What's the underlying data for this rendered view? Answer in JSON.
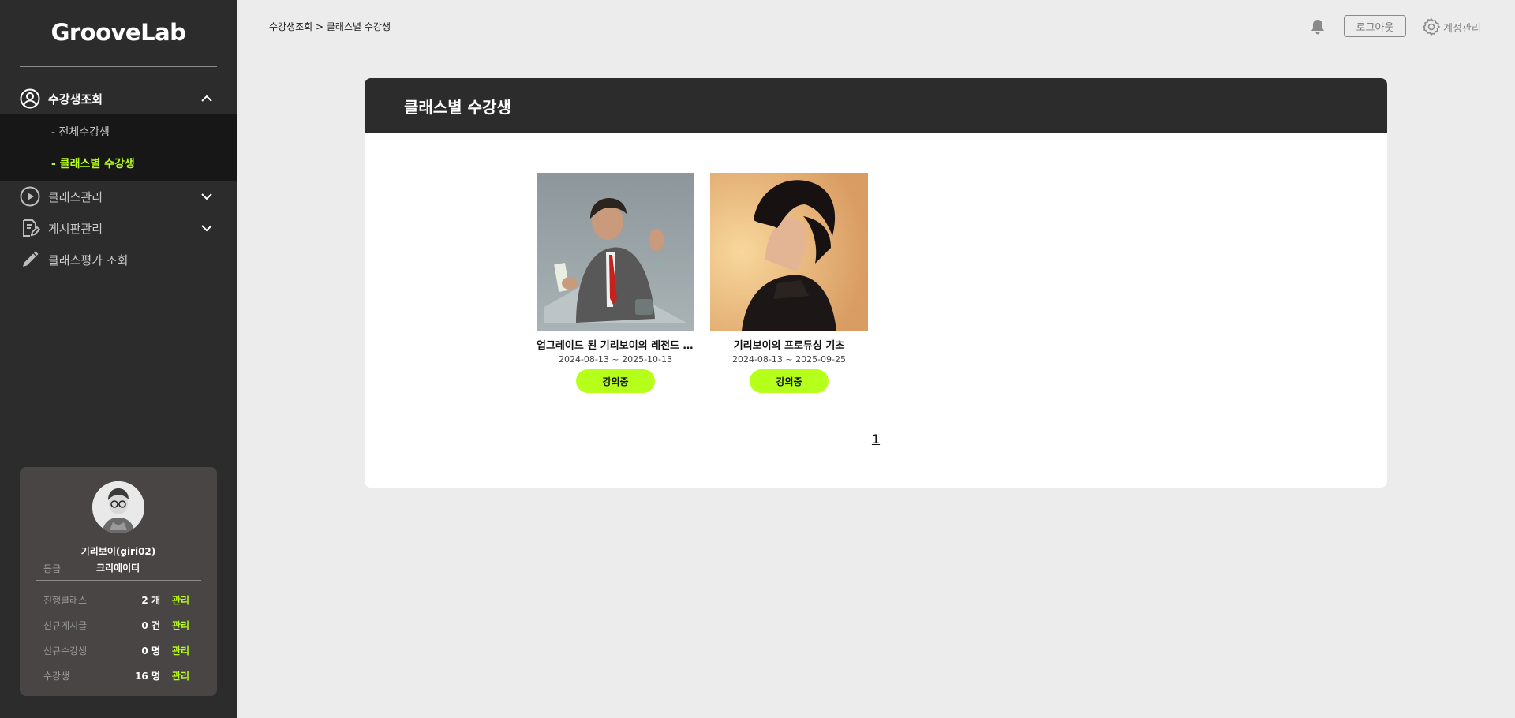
{
  "sidebar": {
    "logo": "GrooveLab",
    "menu": [
      {
        "label": "수강생조회",
        "icon": "user-circle-icon",
        "expanded": true
      },
      {
        "label": "클래스관리",
        "icon": "play-circle-icon",
        "expanded": false
      },
      {
        "label": "게시판관리",
        "icon": "document-edit-icon",
        "expanded": false
      },
      {
        "label": "클래스평가 조회",
        "icon": "pencil-icon"
      }
    ],
    "submenu": [
      {
        "label": "- 전체수강생",
        "current": false
      },
      {
        "label": "- 클래스별 수강생",
        "current": true
      }
    ]
  },
  "profile": {
    "name": "기리보이(giri02)",
    "grade_label": "등급",
    "grade_value": "크리에이터",
    "stats": [
      {
        "label": "진행클래스",
        "value": "2 개",
        "action": "관리"
      },
      {
        "label": "신규게시글",
        "value": "0 건",
        "action": "관리"
      },
      {
        "label": "신규수강생",
        "value": "0 명",
        "action": "관리"
      },
      {
        "label": "수강생",
        "value": "16 명",
        "action": "관리"
      }
    ]
  },
  "header": {
    "breadcrumb": "수강생조회 > 클래스별 수강생",
    "logout": "로그아웃",
    "account": "계정관리"
  },
  "panel": {
    "title": "클래스별 수강생",
    "classes": [
      {
        "title": "업그레이드 된 기리보이의 레전드 작사 노하우",
        "period": "2024-08-13 ~ 2025-10-13",
        "status": "강의중"
      },
      {
        "title": "기리보이의 프로듀싱 기초",
        "period": "2024-08-13 ~ 2025-09-25",
        "status": "강의중"
      }
    ],
    "pages": [
      "1"
    ]
  },
  "colors": {
    "accent": "#b6ff1a",
    "sidebar_bg": "#2c2c2c",
    "page_bg": "#ececec"
  }
}
